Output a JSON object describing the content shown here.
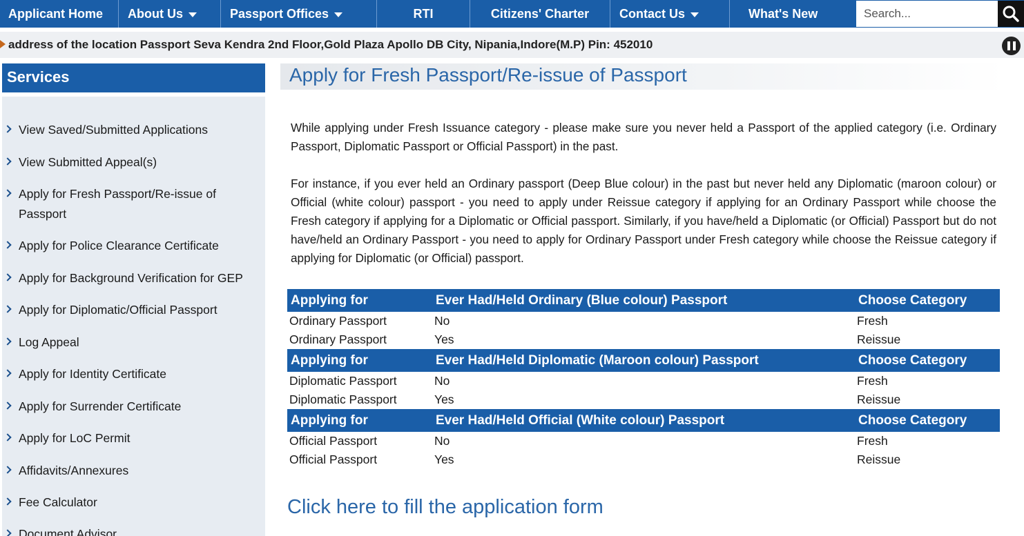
{
  "nav": {
    "items": [
      {
        "label": "Applicant Home",
        "dropdown": false
      },
      {
        "label": "About Us",
        "dropdown": true
      },
      {
        "label": "Passport Offices",
        "dropdown": true
      },
      {
        "label": "RTI",
        "dropdown": false
      },
      {
        "label": "Citizens' Charter",
        "dropdown": false
      },
      {
        "label": "Contact Us",
        "dropdown": true
      },
      {
        "label": "What's New",
        "dropdown": false
      }
    ],
    "search_placeholder": "Search..."
  },
  "marquee": {
    "text": "address of the location Passport Seva Kendra 2nd Floor,Gold Plaza Apollo DB City, Nipania,Indore(M.P) Pin: 452010"
  },
  "sidebar": {
    "title": "Services",
    "items": [
      {
        "label": "View Saved/Submitted Applications"
      },
      {
        "label": "View Submitted Appeal(s)"
      },
      {
        "label": "Apply for Fresh Passport/Re-issue of Passport"
      },
      {
        "label": "Apply for Police Clearance Certificate"
      },
      {
        "label": "Apply for Background Verification for GEP"
      },
      {
        "label": "Apply for Diplomatic/Official Passport"
      },
      {
        "label": "Log Appeal"
      },
      {
        "label": "Apply for Identity Certificate"
      },
      {
        "label": "Apply for Surrender Certificate"
      },
      {
        "label": "Apply for LoC Permit"
      },
      {
        "label": "Affidavits/Annexures"
      },
      {
        "label": "Fee Calculator"
      },
      {
        "label": "Document Advisor"
      }
    ]
  },
  "main": {
    "title": "Apply for Fresh Passport/Re-issue of Passport",
    "para1": "While applying under Fresh Issuance category - please make sure you never held a Passport of the applied category (i.e. Ordinary Passport, Diplomatic Passport or Official Passport) in the past.",
    "para2": "For instance, if you ever held an Ordinary passport (Deep Blue colour) in the past but never held any Diplomatic (maroon colour) or Official (white colour) passport - you need to apply under Reissue category if applying for an Ordinary Passport while choose the Fresh category if applying for a Diplomatic or Official passport. Similarly, if you have/held a Diplomatic (or Official) Passport but do not have/held an Ordinary Passport - you need to apply for Ordinary Passport under Fresh category while choose the Reissue category if applying for Diplomatic (or Official) passport.",
    "table": {
      "sections": [
        {
          "headers": [
            "Applying for",
            "Ever Had/Held Ordinary (Blue colour) Passport",
            "Choose Category"
          ],
          "rows": [
            [
              "Ordinary Passport",
              "No",
              "Fresh"
            ],
            [
              "Ordinary Passport",
              "Yes",
              "Reissue"
            ]
          ]
        },
        {
          "headers": [
            "Applying for",
            "Ever Had/Held Diplomatic (Maroon colour) Passport",
            "Choose Category"
          ],
          "rows": [
            [
              "Diplomatic Passport",
              "No",
              "Fresh"
            ],
            [
              "Diplomatic Passport",
              "Yes",
              "Reissue"
            ]
          ]
        },
        {
          "headers": [
            "Applying for",
            "Ever Had/Held Official (White colour) Passport",
            "Choose Category"
          ],
          "rows": [
            [
              "Official Passport",
              "No",
              "Fresh"
            ],
            [
              "Official Passport",
              "Yes",
              "Reissue"
            ]
          ]
        }
      ]
    },
    "apply_link": "Click here to fill the application form"
  }
}
